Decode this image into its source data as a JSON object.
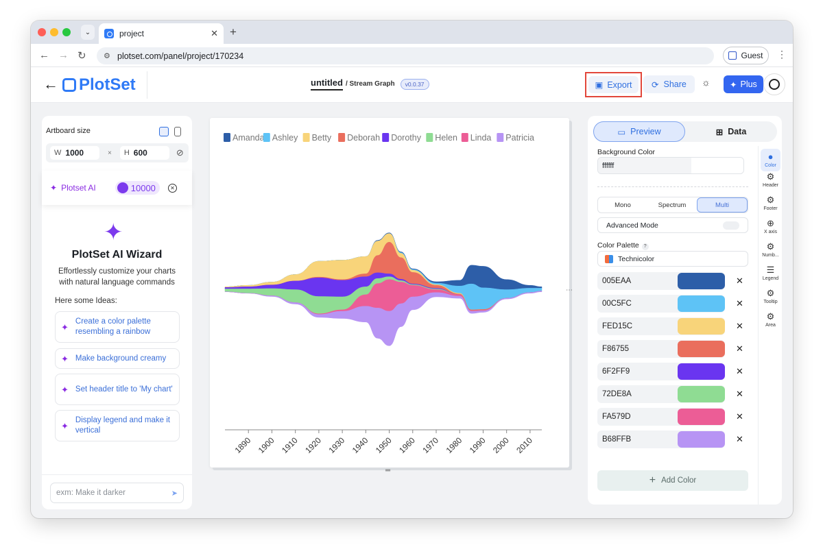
{
  "browser": {
    "tab_title": "project",
    "url": "plotset.com/panel/project/170234",
    "profile_label": "Guest"
  },
  "app": {
    "logo_text": "PlotSet",
    "project_title": "untitled",
    "chart_type_label": "/ Stream Graph",
    "version": "v0.0.37",
    "export_label": "Export",
    "share_label": "Share",
    "plus_label": "Plus"
  },
  "left_panel": {
    "artboard_label": "Artboard size",
    "width_key": "W",
    "width_value": "1000",
    "times_sign": "×",
    "height_key": "H",
    "height_value": "600",
    "ai_label": "Plotset AI",
    "ai_credits": "10000",
    "wizard_title": "PlotSet AI Wizard",
    "wizard_subtitle": "Effortlessly customize your charts with natural language commands",
    "ideas_label": "Here some Ideas:",
    "ideas": [
      "Create a color palette resembling a rainbow",
      "Make background creamy",
      "Set header title to 'My chart'",
      "Display legend and make it vertical"
    ],
    "prompt_placeholder": "exm: Make it darker"
  },
  "right_panel": {
    "tab_preview": "Preview",
    "tab_data": "Data",
    "bg_color_label": "Background Color",
    "bg_color_value": "ffffff",
    "modes": [
      "Mono",
      "Spectrum",
      "Multi"
    ],
    "active_mode": "Multi",
    "advanced_mode_label": "Advanced Mode",
    "color_palette_label": "Color Palette",
    "palette_name": "Technicolor",
    "colors": [
      {
        "hex": "005EAA",
        "swatch": "#2d5ea8"
      },
      {
        "hex": "00C5FC",
        "swatch": "#5ec3f6"
      },
      {
        "hex": "FED15C",
        "swatch": "#f8d47a"
      },
      {
        "hex": "F86755",
        "swatch": "#ea6e5d"
      },
      {
        "hex": "6F2FF9",
        "swatch": "#6a35f0"
      },
      {
        "hex": "72DE8A",
        "swatch": "#8fdc93"
      },
      {
        "hex": "FA579D",
        "swatch": "#ec5d96"
      },
      {
        "hex": "B68FFB",
        "swatch": "#b794f4"
      }
    ],
    "add_color_label": "Add Color",
    "rail": [
      {
        "label": "Color",
        "icon": "palette-icon"
      },
      {
        "label": "Header",
        "icon": "gear-icon"
      },
      {
        "label": "Footer",
        "icon": "gear-icon"
      },
      {
        "label": "X axis",
        "icon": "axis-icon"
      },
      {
        "label": "Numb...",
        "icon": "gear-icon"
      },
      {
        "label": "Legend",
        "icon": "legend-icon"
      },
      {
        "label": "Tooltip",
        "icon": "gear-icon"
      },
      {
        "label": "Area",
        "icon": "gear-icon"
      }
    ]
  },
  "chart_data": {
    "type": "area",
    "subtype": "streamgraph",
    "legend_position": "top-left",
    "x": [
      1880,
      1890,
      1900,
      1910,
      1920,
      1930,
      1940,
      1945,
      1950,
      1955,
      1960,
      1970,
      1980,
      1985,
      1990,
      2000,
      2010,
      2015
    ],
    "x_ticks": [
      "1890",
      "1900",
      "1910",
      "1920",
      "1930",
      "1940",
      "1950",
      "1960",
      "1970",
      "1980",
      "1990",
      "2000",
      "2010"
    ],
    "series": [
      {
        "name": "Amanda",
        "color": "#2d5ea8",
        "values": [
          0,
          0,
          0,
          0,
          0,
          0,
          0,
          1,
          1,
          1,
          1,
          2,
          8,
          26,
          30,
          14,
          4,
          2
        ]
      },
      {
        "name": "Ashley",
        "color": "#5ec3f6",
        "values": [
          0,
          0,
          0,
          0,
          0,
          0,
          0,
          0,
          0,
          1,
          1,
          2,
          10,
          36,
          30,
          12,
          6,
          4
        ]
      },
      {
        "name": "Betty",
        "color": "#f8d47a",
        "values": [
          1,
          2,
          4,
          9,
          22,
          27,
          24,
          20,
          12,
          6,
          3,
          1,
          1,
          0,
          0,
          0,
          0,
          0
        ]
      },
      {
        "name": "Deborah",
        "color": "#ea6e5d",
        "values": [
          0,
          0,
          0,
          0,
          1,
          1,
          4,
          24,
          44,
          30,
          16,
          4,
          1,
          1,
          1,
          0,
          0,
          0
        ]
      },
      {
        "name": "Dorothy",
        "color": "#6a35f0",
        "values": [
          2,
          3,
          5,
          12,
          26,
          23,
          14,
          8,
          4,
          2,
          1,
          1,
          0,
          0,
          0,
          0,
          0,
          0
        ]
      },
      {
        "name": "Helen",
        "color": "#8fdc93",
        "values": [
          4,
          6,
          10,
          18,
          24,
          18,
          11,
          7,
          4,
          2,
          1,
          1,
          0,
          0,
          0,
          0,
          0,
          0
        ]
      },
      {
        "name": "Linda",
        "color": "#ec5d96",
        "values": [
          0,
          0,
          0,
          0,
          1,
          2,
          16,
          34,
          44,
          30,
          16,
          4,
          2,
          1,
          1,
          0,
          0,
          0
        ]
      },
      {
        "name": "Patricia",
        "color": "#b794f4",
        "values": [
          0,
          0,
          1,
          2,
          4,
          10,
          22,
          42,
          48,
          32,
          18,
          6,
          3,
          3,
          2,
          1,
          1,
          1
        ]
      }
    ]
  }
}
